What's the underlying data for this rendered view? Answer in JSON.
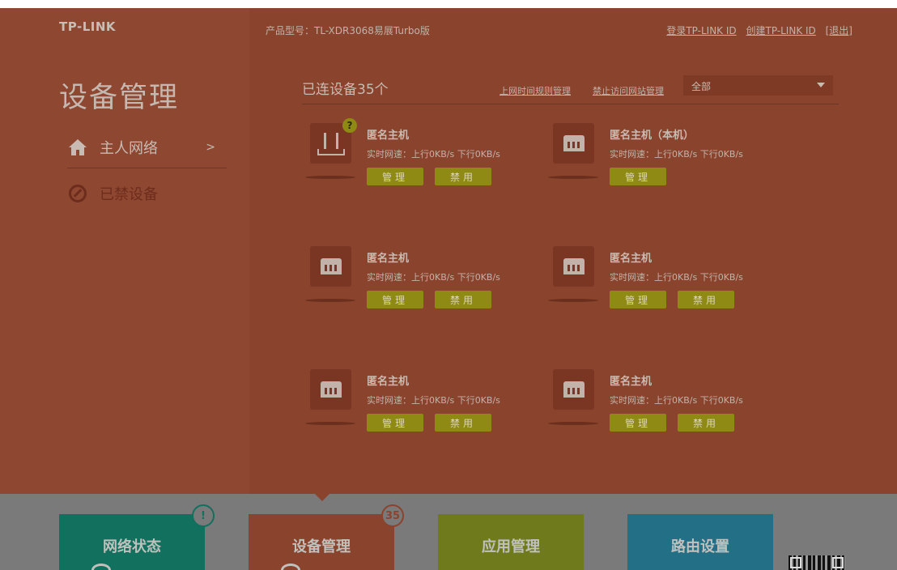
{
  "header": {
    "logo": "TP-LINK",
    "model": "产品型号：TL-XDR3068易展Turbo版",
    "links": [
      "登录TP-LINK ID",
      "创建TP-LINK ID",
      "[退出]"
    ]
  },
  "sidebar": {
    "title": "设备管理",
    "items": [
      {
        "label": "主人网络",
        "chevron": ">",
        "icon": "home-icon"
      },
      {
        "label": "已禁设备",
        "icon": "ban-icon"
      }
    ]
  },
  "main": {
    "count_label": "已连设备35个",
    "link_schedule": "上网时间规则管理",
    "link_block_sites": "禁止访问网站管理",
    "filter": {
      "selected": "全部"
    },
    "devices": [
      {
        "name": "匿名主机",
        "speed": "实时网速：上行0KB/s 下行0KB/s",
        "manage": "管理",
        "ban": "禁用",
        "icon": "router-icon",
        "badge": "?"
      },
      {
        "name": "匿名主机（本机）",
        "speed": "实时网速：上行0KB/s 下行0KB/s",
        "manage": "管理",
        "icon": "ethernet-icon"
      },
      {
        "name": "匿名主机",
        "speed": "实时网速：上行0KB/s 下行0KB/s",
        "manage": "管理",
        "ban": "禁用",
        "icon": "ethernet-icon"
      },
      {
        "name": "匿名主机",
        "speed": "实时网速：上行0KB/s 下行0KB/s",
        "manage": "管理",
        "ban": "禁用",
        "icon": "ethernet-icon"
      },
      {
        "name": "匿名主机",
        "speed": "实时网速：上行0KB/s 下行0KB/s",
        "manage": "管理",
        "ban": "禁用",
        "icon": "ethernet-icon"
      },
      {
        "name": "匿名主机",
        "speed": "实时网速：上行0KB/s 下行0KB/s",
        "manage": "管理",
        "ban": "禁用",
        "icon": "ethernet-icon"
      }
    ]
  },
  "footer": {
    "tiles": [
      {
        "label": "网络状态",
        "badge": "!"
      },
      {
        "label": "设备管理",
        "badge": "35"
      },
      {
        "label": "应用管理"
      },
      {
        "label": "路由设置"
      }
    ]
  },
  "colors": {
    "sidebar_bg": "#8e4730",
    "main_bg": "#8a432c",
    "button": "#8f8a14",
    "tile_network": "#11705e",
    "tile_device": "#8a432c",
    "tile_app": "#6e7a1c",
    "tile_route": "#236f85"
  }
}
